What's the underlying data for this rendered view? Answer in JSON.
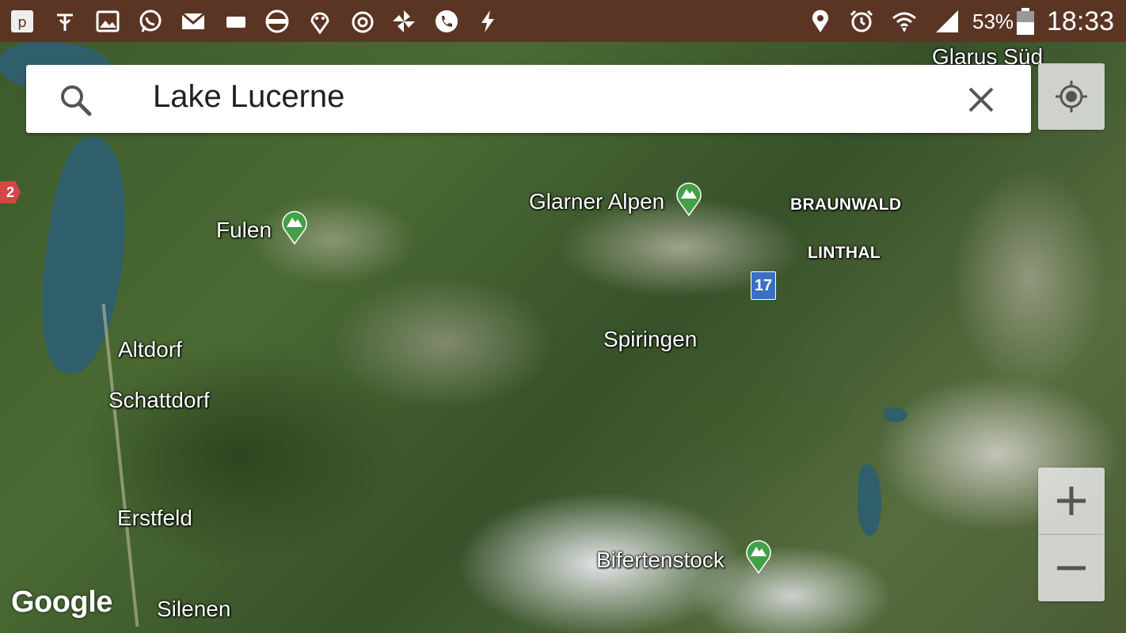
{
  "status_bar": {
    "left_icons": [
      "pocket-icon",
      "notification-icon",
      "gallery-icon",
      "whatsapp-icon",
      "email-icon",
      "tv-icon",
      "transit-icon",
      "smile-icon",
      "power-icon",
      "pinwheel-icon",
      "phone-icon",
      "bolt-icon"
    ],
    "right_icons": [
      "location-icon",
      "alarm-icon",
      "wifi-icon",
      "signal-icon",
      "battery-icon"
    ],
    "battery": "53%",
    "time": "18:33"
  },
  "search": {
    "query": "Lake Lucerne"
  },
  "map": {
    "places": [
      {
        "name": "Glarus Süd"
      },
      {
        "name": "Glarner Alpen"
      },
      {
        "name": "BRAUNWALD"
      },
      {
        "name": "LINTHAL"
      },
      {
        "name": "Fulen"
      },
      {
        "name": "Spiringen"
      },
      {
        "name": "Altdorf"
      },
      {
        "name": "Schattdorf"
      },
      {
        "name": "Erstfeld"
      },
      {
        "name": "Silenen"
      },
      {
        "name": "Bifertenstock"
      }
    ],
    "route_shields": [
      {
        "label": "17"
      },
      {
        "label": "2"
      }
    ],
    "attribution": "Google"
  },
  "colors": {
    "status_bar": "#5b3524",
    "peak_marker": "#43a047",
    "route_shield": "#3b6fc4",
    "route_shield_alt": "#d64545"
  }
}
